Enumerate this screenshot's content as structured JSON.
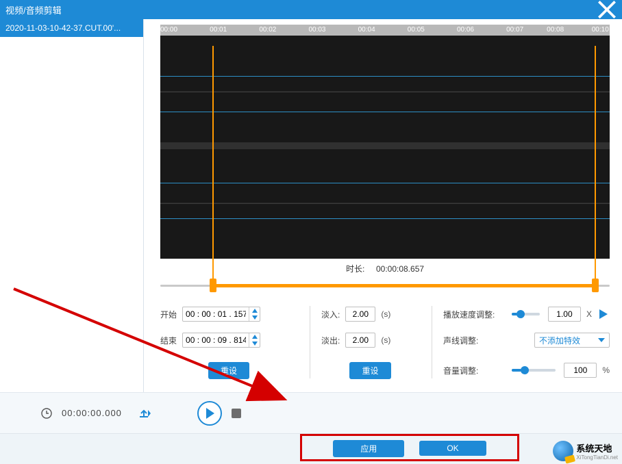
{
  "window": {
    "title": "视频/音频剪辑"
  },
  "sidebar": {
    "file": "2020-11-03-10-42-37.CUT.00'..."
  },
  "ruler": [
    "00:00",
    "00:01",
    "00:02",
    "00:03",
    "00:04",
    "00:05",
    "00:06",
    "00:07",
    "00:08",
    "00:10"
  ],
  "duration": {
    "label": "时长:",
    "value": "00:00:08.657"
  },
  "trim": {
    "start_label": "开始",
    "start_value": "00 : 00 : 01 . 157",
    "end_label": "结束",
    "end_value": "00 : 00 : 09 . 814",
    "reset": "重设"
  },
  "fade": {
    "in_label": "淡入:",
    "in_value": "2.00",
    "out_label": "淡出:",
    "out_value": "2.00",
    "unit": "(s)",
    "reset": "重设"
  },
  "adjust": {
    "speed_label": "播放速度调整:",
    "speed_value": "1.00",
    "speed_unit": "X",
    "voice_label": "声线调整:",
    "voice_value": "不添加特效",
    "volume_label": "音量调整:",
    "volume_value": "100",
    "volume_unit": "%"
  },
  "playbar": {
    "time": "00:00:00.000"
  },
  "actions": {
    "apply": "应用",
    "ok": "OK"
  },
  "branding": {
    "name": "系统天地",
    "url": "XiTongTianDi.net"
  }
}
